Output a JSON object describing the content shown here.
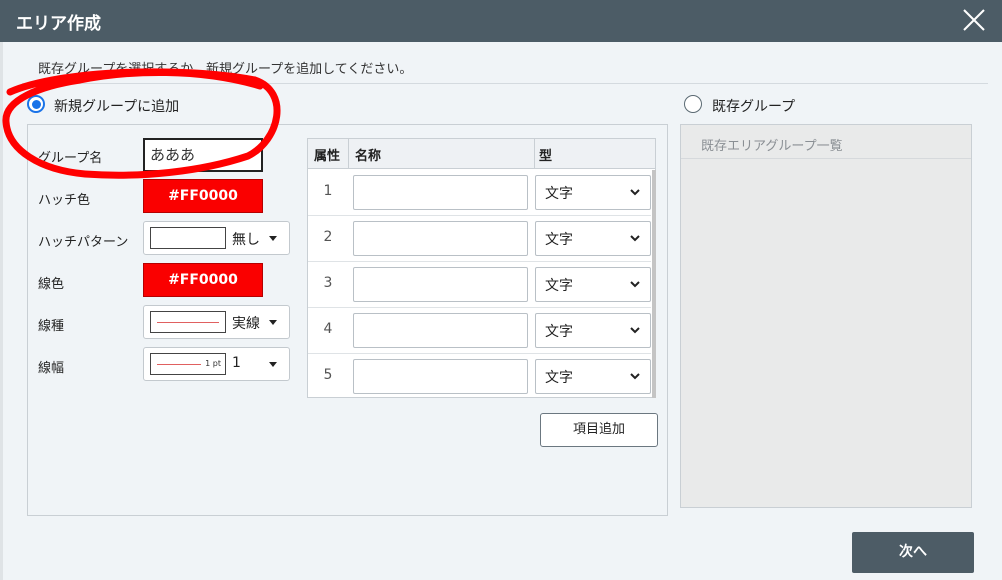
{
  "dialog": {
    "title": "エリア作成",
    "instruction": "既存グループを選択するか、新規グループを追加してください。",
    "close_icon": "close-icon"
  },
  "mode": {
    "new_group_label": "新規グループに追加",
    "existing_group_label": "既存グループ",
    "selected": "new"
  },
  "form": {
    "group_name_label": "グループ名",
    "group_name_value": "あああ",
    "hatch_color_label": "ハッチ色",
    "hatch_color_value": "#FF0000",
    "hatch_pattern_label": "ハッチパターン",
    "hatch_pattern_value": "無し",
    "line_color_label": "線色",
    "line_color_value": "#FF0000",
    "line_type_label": "線種",
    "line_type_value": "実線",
    "line_width_label": "線幅",
    "line_width_value": "1",
    "line_width_unit": "1 pt"
  },
  "attributes_table": {
    "headers": [
      "属性",
      "名称",
      "型"
    ],
    "rows": [
      {
        "index": "1",
        "name": "",
        "type": "文字"
      },
      {
        "index": "2",
        "name": "",
        "type": "文字"
      },
      {
        "index": "3",
        "name": "",
        "type": "文字"
      },
      {
        "index": "4",
        "name": "",
        "type": "文字"
      },
      {
        "index": "5",
        "name": "",
        "type": "文字"
      }
    ],
    "add_button_label": "項目追加"
  },
  "existing_list": {
    "header": "既存エリアグループ一覧"
  },
  "footer": {
    "next_label": "次へ"
  },
  "colors": {
    "title_bar": "#4c5c66",
    "hatch_color": "#fa0000",
    "radio_accent": "#1a73e8",
    "annotation": "#ff0000"
  }
}
